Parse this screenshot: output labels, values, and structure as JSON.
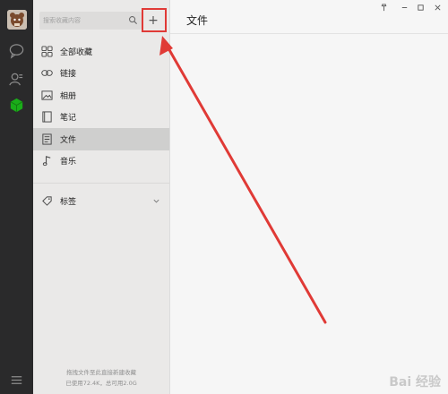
{
  "window": {
    "controls": [
      "pin-icon",
      "minimize-icon",
      "maximize-icon",
      "close-icon"
    ]
  },
  "rail": {
    "icons": [
      "chat-icon",
      "contacts-icon",
      "favorites-cube-icon",
      "menu-icon"
    ],
    "accent": "#1aad19"
  },
  "search": {
    "placeholder": "搜索收藏内容"
  },
  "add_button": {
    "label": "+"
  },
  "nav": {
    "items": [
      {
        "label": "全部收藏",
        "icon": "grid-icon"
      },
      {
        "label": "链接",
        "icon": "link-icon"
      },
      {
        "label": "相册",
        "icon": "image-icon"
      },
      {
        "label": "笔记",
        "icon": "note-icon"
      },
      {
        "label": "文件",
        "icon": "file-icon",
        "active": true
      },
      {
        "label": "音乐",
        "icon": "music-icon"
      }
    ]
  },
  "tags": {
    "label": "标签",
    "icon": "tag-icon"
  },
  "footer": {
    "line1": "拖拽文件至此直接新建收藏",
    "line2": "已使用72.4K，总可用2.0G"
  },
  "content": {
    "title": "文件"
  },
  "annotation": {
    "color": "#e03a36"
  },
  "watermark": {
    "text": "Bai 经验"
  }
}
